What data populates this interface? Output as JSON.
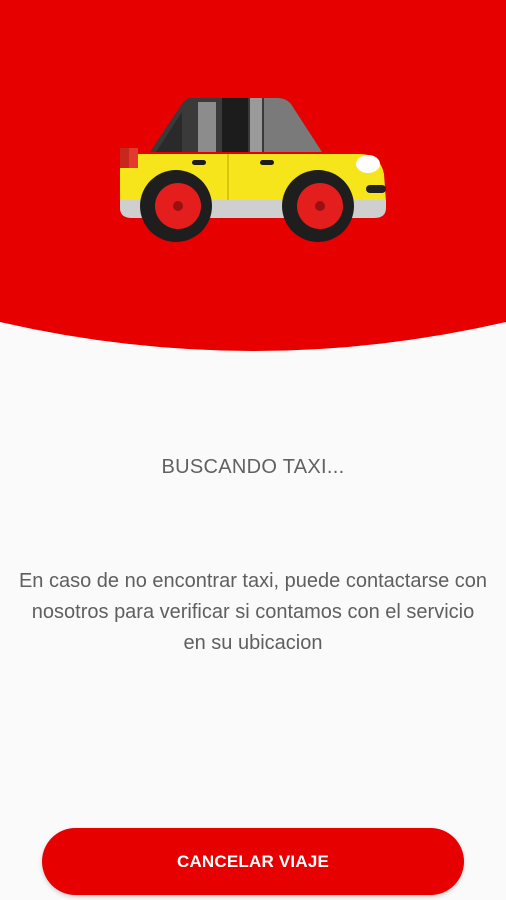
{
  "colors": {
    "brand_red": "#e60000",
    "background": "#fafafa",
    "text_gray": "#616161",
    "taxi_yellow": "#f6e51a"
  },
  "header": {
    "icon": "taxi-car-icon"
  },
  "status": {
    "text": "BUSCANDO TAXI..."
  },
  "info": {
    "text": "En caso de no encontrar taxi, puede contactarse con nosotros para verificar si contamos con el servicio en su ubicacion"
  },
  "actions": {
    "cancel_label": "CANCELAR VIAJE"
  }
}
